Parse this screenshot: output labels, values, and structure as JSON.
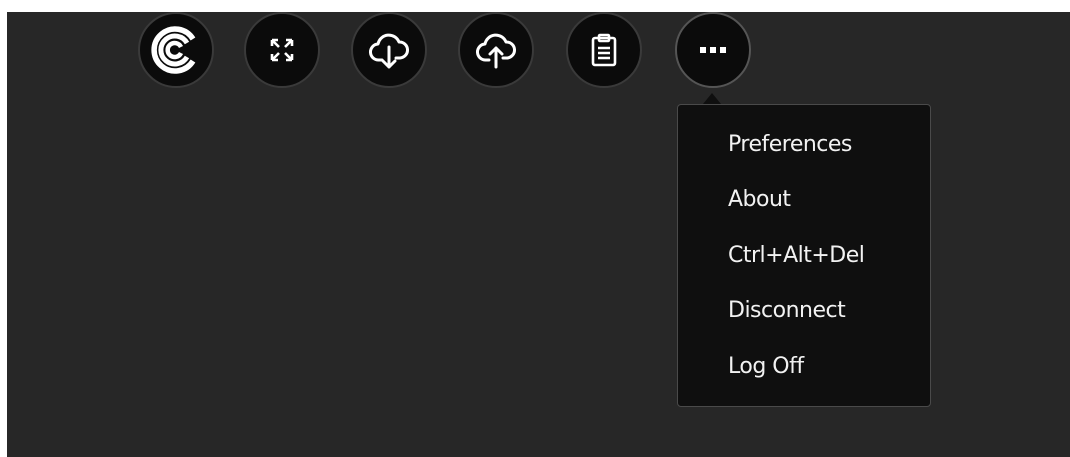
{
  "toolbar": {
    "buttons": [
      {
        "name": "citrix-logo"
      },
      {
        "name": "fullscreen"
      },
      {
        "name": "download"
      },
      {
        "name": "upload"
      },
      {
        "name": "clipboard"
      },
      {
        "name": "more"
      }
    ]
  },
  "menu": {
    "items": [
      {
        "label": "Preferences"
      },
      {
        "label": "About"
      },
      {
        "label": "Ctrl+Alt+Del"
      },
      {
        "label": "Disconnect"
      },
      {
        "label": "Log Off"
      }
    ]
  },
  "colors": {
    "background": "#272727",
    "button_fill": "#0b0b0b",
    "menu_fill": "#0f0f0f",
    "text": "#f2f2f2"
  }
}
